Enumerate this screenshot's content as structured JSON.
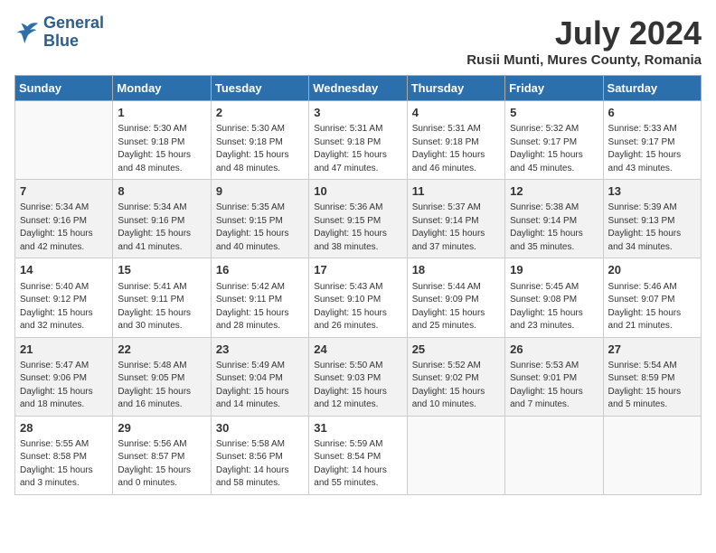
{
  "header": {
    "logo_line1": "General",
    "logo_line2": "Blue",
    "month_year": "July 2024",
    "location": "Rusii Munti, Mures County, Romania"
  },
  "weekdays": [
    "Sunday",
    "Monday",
    "Tuesday",
    "Wednesday",
    "Thursday",
    "Friday",
    "Saturday"
  ],
  "weeks": [
    [
      {
        "day": "",
        "info": ""
      },
      {
        "day": "1",
        "info": "Sunrise: 5:30 AM\nSunset: 9:18 PM\nDaylight: 15 hours\nand 48 minutes."
      },
      {
        "day": "2",
        "info": "Sunrise: 5:30 AM\nSunset: 9:18 PM\nDaylight: 15 hours\nand 48 minutes."
      },
      {
        "day": "3",
        "info": "Sunrise: 5:31 AM\nSunset: 9:18 PM\nDaylight: 15 hours\nand 47 minutes."
      },
      {
        "day": "4",
        "info": "Sunrise: 5:31 AM\nSunset: 9:18 PM\nDaylight: 15 hours\nand 46 minutes."
      },
      {
        "day": "5",
        "info": "Sunrise: 5:32 AM\nSunset: 9:17 PM\nDaylight: 15 hours\nand 45 minutes."
      },
      {
        "day": "6",
        "info": "Sunrise: 5:33 AM\nSunset: 9:17 PM\nDaylight: 15 hours\nand 43 minutes."
      }
    ],
    [
      {
        "day": "7",
        "info": "Sunrise: 5:34 AM\nSunset: 9:16 PM\nDaylight: 15 hours\nand 42 minutes."
      },
      {
        "day": "8",
        "info": "Sunrise: 5:34 AM\nSunset: 9:16 PM\nDaylight: 15 hours\nand 41 minutes."
      },
      {
        "day": "9",
        "info": "Sunrise: 5:35 AM\nSunset: 9:15 PM\nDaylight: 15 hours\nand 40 minutes."
      },
      {
        "day": "10",
        "info": "Sunrise: 5:36 AM\nSunset: 9:15 PM\nDaylight: 15 hours\nand 38 minutes."
      },
      {
        "day": "11",
        "info": "Sunrise: 5:37 AM\nSunset: 9:14 PM\nDaylight: 15 hours\nand 37 minutes."
      },
      {
        "day": "12",
        "info": "Sunrise: 5:38 AM\nSunset: 9:14 PM\nDaylight: 15 hours\nand 35 minutes."
      },
      {
        "day": "13",
        "info": "Sunrise: 5:39 AM\nSunset: 9:13 PM\nDaylight: 15 hours\nand 34 minutes."
      }
    ],
    [
      {
        "day": "14",
        "info": "Sunrise: 5:40 AM\nSunset: 9:12 PM\nDaylight: 15 hours\nand 32 minutes."
      },
      {
        "day": "15",
        "info": "Sunrise: 5:41 AM\nSunset: 9:11 PM\nDaylight: 15 hours\nand 30 minutes."
      },
      {
        "day": "16",
        "info": "Sunrise: 5:42 AM\nSunset: 9:11 PM\nDaylight: 15 hours\nand 28 minutes."
      },
      {
        "day": "17",
        "info": "Sunrise: 5:43 AM\nSunset: 9:10 PM\nDaylight: 15 hours\nand 26 minutes."
      },
      {
        "day": "18",
        "info": "Sunrise: 5:44 AM\nSunset: 9:09 PM\nDaylight: 15 hours\nand 25 minutes."
      },
      {
        "day": "19",
        "info": "Sunrise: 5:45 AM\nSunset: 9:08 PM\nDaylight: 15 hours\nand 23 minutes."
      },
      {
        "day": "20",
        "info": "Sunrise: 5:46 AM\nSunset: 9:07 PM\nDaylight: 15 hours\nand 21 minutes."
      }
    ],
    [
      {
        "day": "21",
        "info": "Sunrise: 5:47 AM\nSunset: 9:06 PM\nDaylight: 15 hours\nand 18 minutes."
      },
      {
        "day": "22",
        "info": "Sunrise: 5:48 AM\nSunset: 9:05 PM\nDaylight: 15 hours\nand 16 minutes."
      },
      {
        "day": "23",
        "info": "Sunrise: 5:49 AM\nSunset: 9:04 PM\nDaylight: 15 hours\nand 14 minutes."
      },
      {
        "day": "24",
        "info": "Sunrise: 5:50 AM\nSunset: 9:03 PM\nDaylight: 15 hours\nand 12 minutes."
      },
      {
        "day": "25",
        "info": "Sunrise: 5:52 AM\nSunset: 9:02 PM\nDaylight: 15 hours\nand 10 minutes."
      },
      {
        "day": "26",
        "info": "Sunrise: 5:53 AM\nSunset: 9:01 PM\nDaylight: 15 hours\nand 7 minutes."
      },
      {
        "day": "27",
        "info": "Sunrise: 5:54 AM\nSunset: 8:59 PM\nDaylight: 15 hours\nand 5 minutes."
      }
    ],
    [
      {
        "day": "28",
        "info": "Sunrise: 5:55 AM\nSunset: 8:58 PM\nDaylight: 15 hours\nand 3 minutes."
      },
      {
        "day": "29",
        "info": "Sunrise: 5:56 AM\nSunset: 8:57 PM\nDaylight: 15 hours\nand 0 minutes."
      },
      {
        "day": "30",
        "info": "Sunrise: 5:58 AM\nSunset: 8:56 PM\nDaylight: 14 hours\nand 58 minutes."
      },
      {
        "day": "31",
        "info": "Sunrise: 5:59 AM\nSunset: 8:54 PM\nDaylight: 14 hours\nand 55 minutes."
      },
      {
        "day": "",
        "info": ""
      },
      {
        "day": "",
        "info": ""
      },
      {
        "day": "",
        "info": ""
      }
    ]
  ]
}
